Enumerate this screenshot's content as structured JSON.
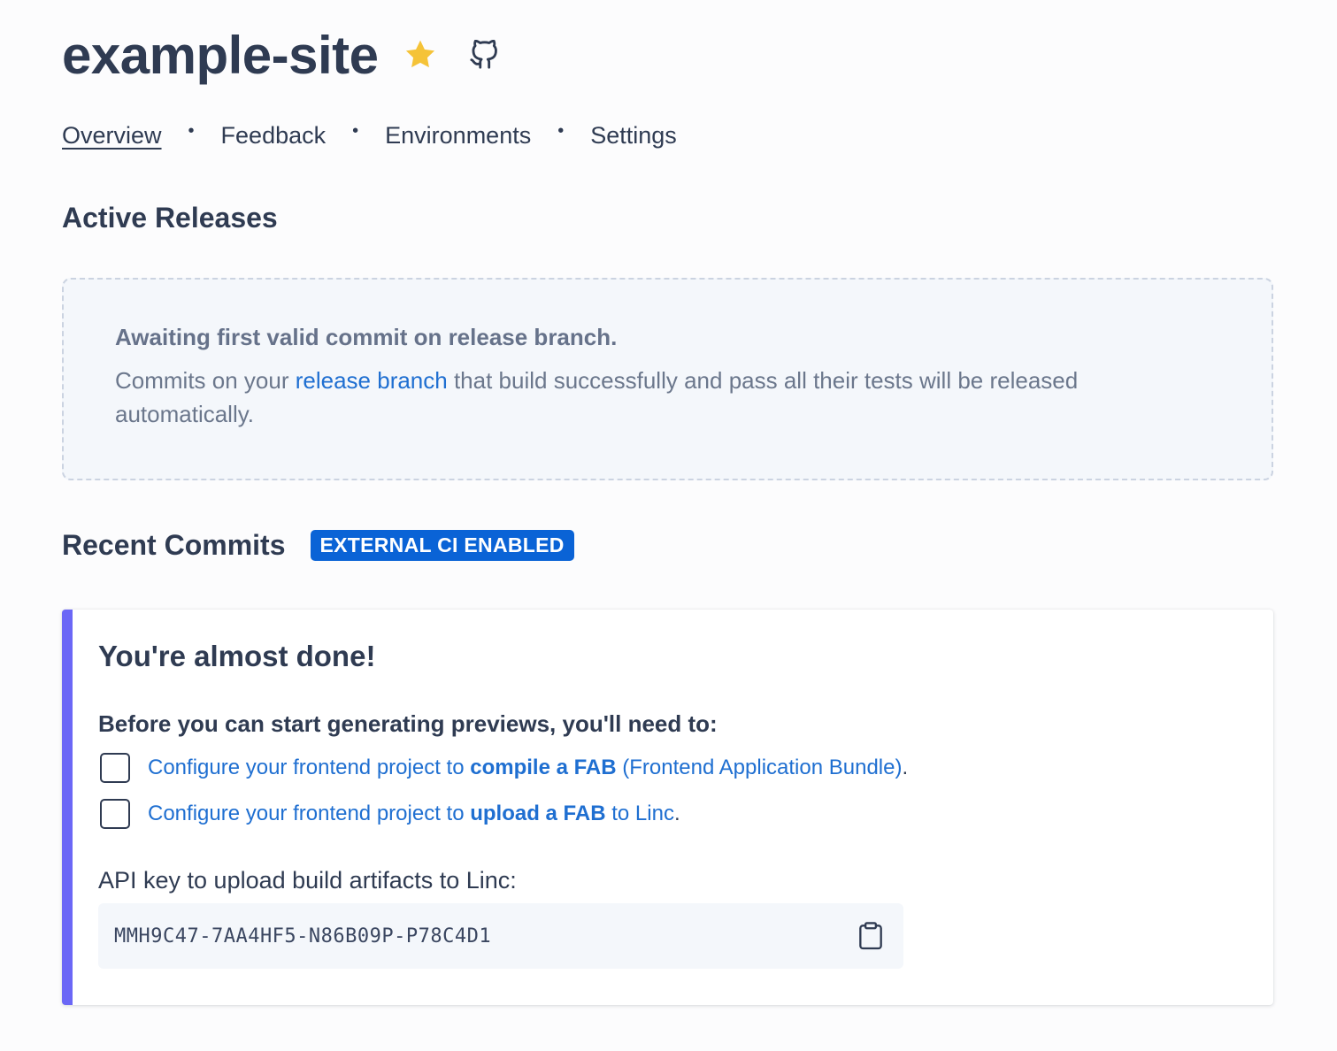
{
  "header": {
    "title": "example-site",
    "star_color": "#f5c338"
  },
  "nav": {
    "items": [
      {
        "label": "Overview",
        "active": true
      },
      {
        "label": "Feedback"
      },
      {
        "label": "Environments"
      },
      {
        "label": "Settings"
      }
    ],
    "separator": "•"
  },
  "active_releases": {
    "heading": "Active Releases",
    "empty_title": "Awaiting first valid commit on release branch.",
    "text_before": "Commits on your ",
    "link_text": "release branch",
    "text_after": " that build successfully and pass all their tests will be released automatically."
  },
  "recent_commits": {
    "heading": "Recent Commits",
    "badge": "EXTERNAL CI ENABLED",
    "badge_color": "#0a63d6"
  },
  "setup_card": {
    "title": "You're almost done!",
    "intro": "Before you can start generating previews, you'll need to:",
    "accent_color": "#6b67f6",
    "tasks": [
      {
        "prefix": "Configure your frontend project to ",
        "bold": "compile a FAB",
        "suffix": " (Frontend Application Bundle)",
        "end": ".",
        "checked": false
      },
      {
        "prefix": "Configure your frontend project to ",
        "bold": "upload a FAB",
        "suffix": " to Linc",
        "end": ".",
        "checked": false
      }
    ],
    "api_label": "API key to upload build artifacts to Linc:",
    "api_key": "MMH9C47-7AA4HF5-N86B09P-P78C4D1"
  }
}
